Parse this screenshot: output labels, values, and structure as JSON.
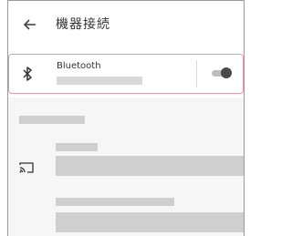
{
  "header": {
    "title": "機器接続",
    "back_icon": "arrow-left-icon"
  },
  "bluetooth_row": {
    "label": "Bluetooth",
    "icon": "bluetooth-icon",
    "toggle_state": "off",
    "highlight_color": "#e89aaf"
  },
  "cast_item": {
    "icon": "cast-icon"
  },
  "colors": {
    "placeholder_bar": "#cfcfcf",
    "section_background": "#f6f6f6"
  }
}
